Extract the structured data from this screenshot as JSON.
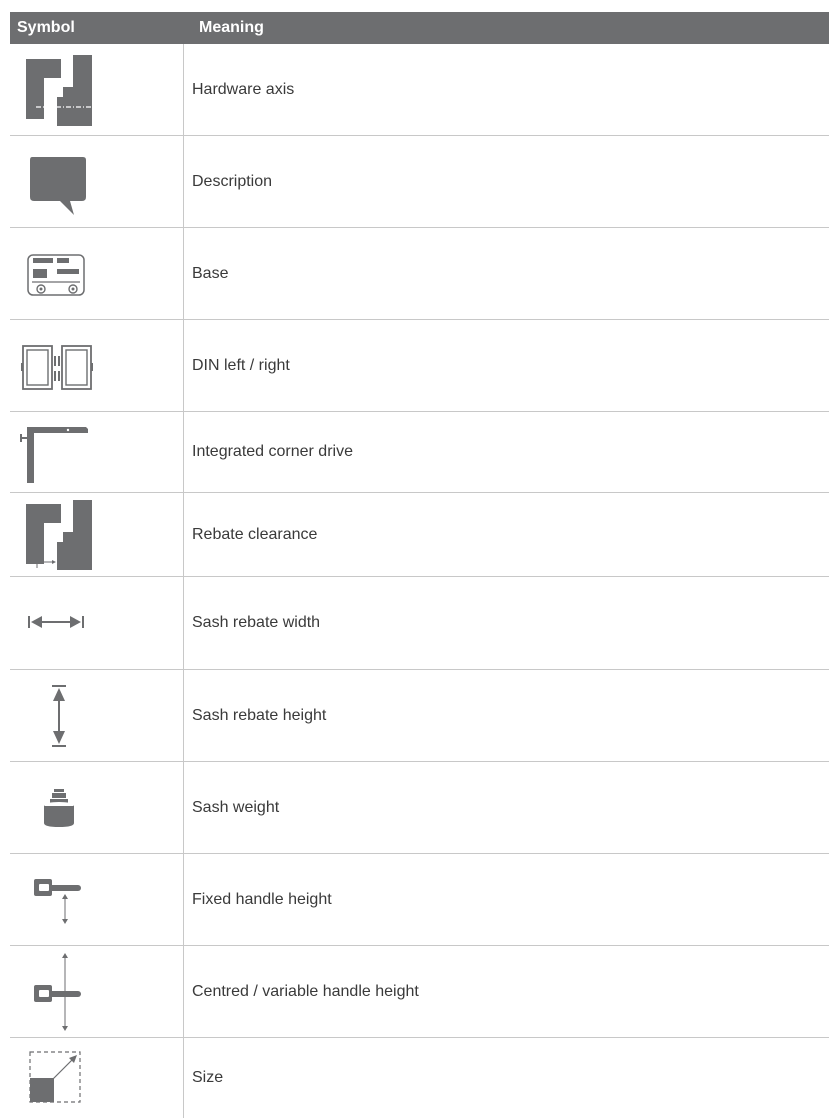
{
  "table": {
    "headers": {
      "symbol": "Symbol",
      "meaning": "Meaning"
    },
    "rows": [
      {
        "icon": "hardware-axis-icon",
        "meaning": "Hardware axis"
      },
      {
        "icon": "description-icon",
        "meaning": "Description"
      },
      {
        "icon": "base-icon",
        "meaning": "Base"
      },
      {
        "icon": "din-left-right-icon",
        "meaning": "DIN left / right"
      },
      {
        "icon": "corner-drive-icon",
        "meaning": "Integrated corner drive"
      },
      {
        "icon": "rebate-clearance-icon",
        "meaning": "Rebate clearance"
      },
      {
        "icon": "sash-rebate-width-icon",
        "meaning": "Sash rebate width"
      },
      {
        "icon": "sash-rebate-height-icon",
        "meaning": "Sash rebate height"
      },
      {
        "icon": "sash-weight-icon",
        "meaning": "Sash weight"
      },
      {
        "icon": "fixed-handle-height-icon",
        "meaning": "Fixed handle height"
      },
      {
        "icon": "variable-handle-height-icon",
        "meaning": "Centred / variable handle height"
      },
      {
        "icon": "size-icon",
        "meaning": "Size"
      }
    ]
  },
  "colors": {
    "header_bg": "#6d6e70",
    "icon": "#6d6e70",
    "grid": "#c8c8c8",
    "text": "#3a3a3a"
  }
}
